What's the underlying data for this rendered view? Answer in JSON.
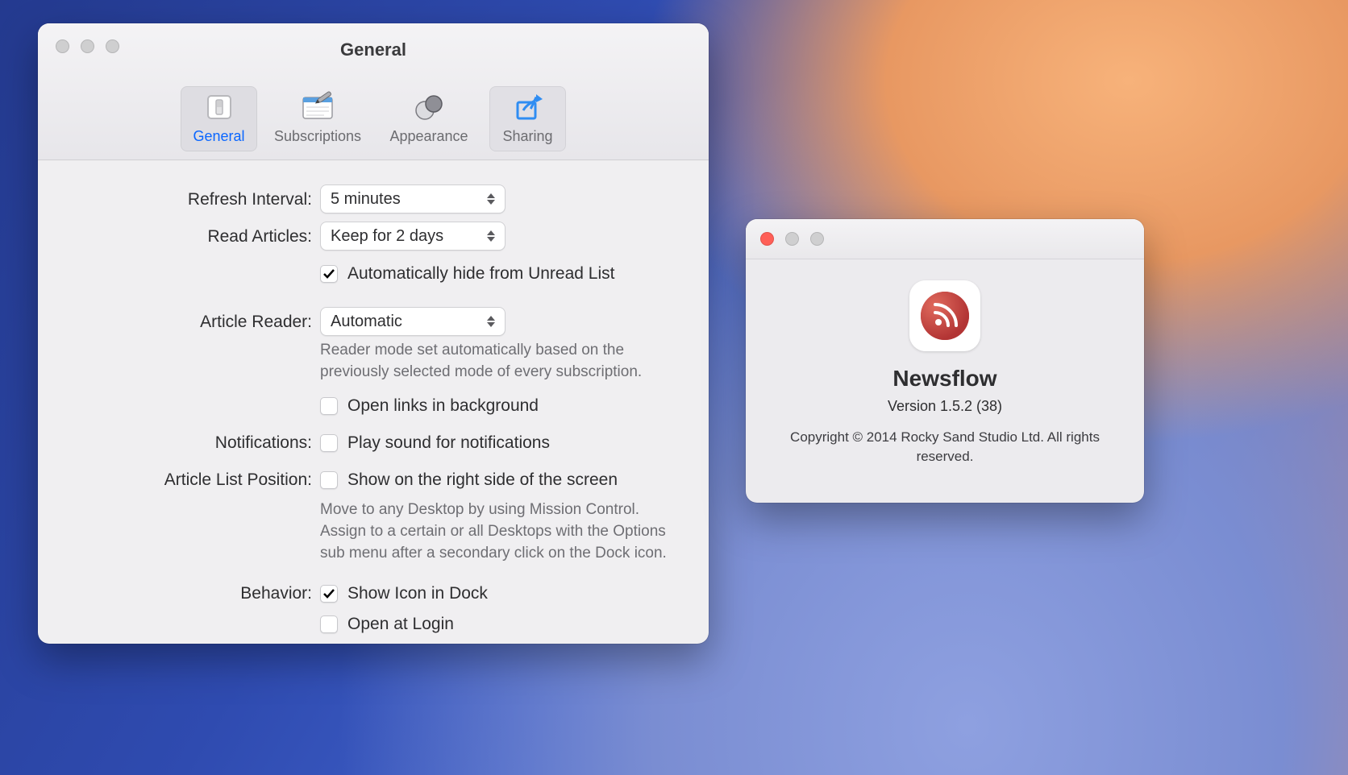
{
  "prefs": {
    "title": "General",
    "tabs": {
      "general": "General",
      "subscriptions": "Subscriptions",
      "appearance": "Appearance",
      "sharing": "Sharing"
    },
    "labels": {
      "refresh": "Refresh Interval:",
      "read": "Read Articles:",
      "reader": "Article Reader:",
      "notif": "Notifications:",
      "listpos": "Article List Position:",
      "behavior": "Behavior:"
    },
    "values": {
      "refresh": "5 minutes",
      "read": "Keep for 2 days",
      "reader": "Automatic"
    },
    "checks": {
      "auto_hide": "Automatically hide from Unread List",
      "open_bg": "Open links in background",
      "play_sound": "Play sound for notifications",
      "show_right": "Show on the right side of the screen",
      "show_dock": "Show Icon in Dock",
      "open_login": "Open at Login"
    },
    "hints": {
      "reader": "Reader mode set automatically based on the previously selected mode of every subscription.",
      "listpos": "Move to any Desktop by using Mission Control. Assign to a certain or all Desktops with the Options sub menu after a secondary click on the Dock icon."
    }
  },
  "about": {
    "name": "Newsflow",
    "version": "Version 1.5.2 (38)",
    "copyright": "Copyright © 2014 Rocky Sand Studio Ltd. All rights reserved."
  }
}
